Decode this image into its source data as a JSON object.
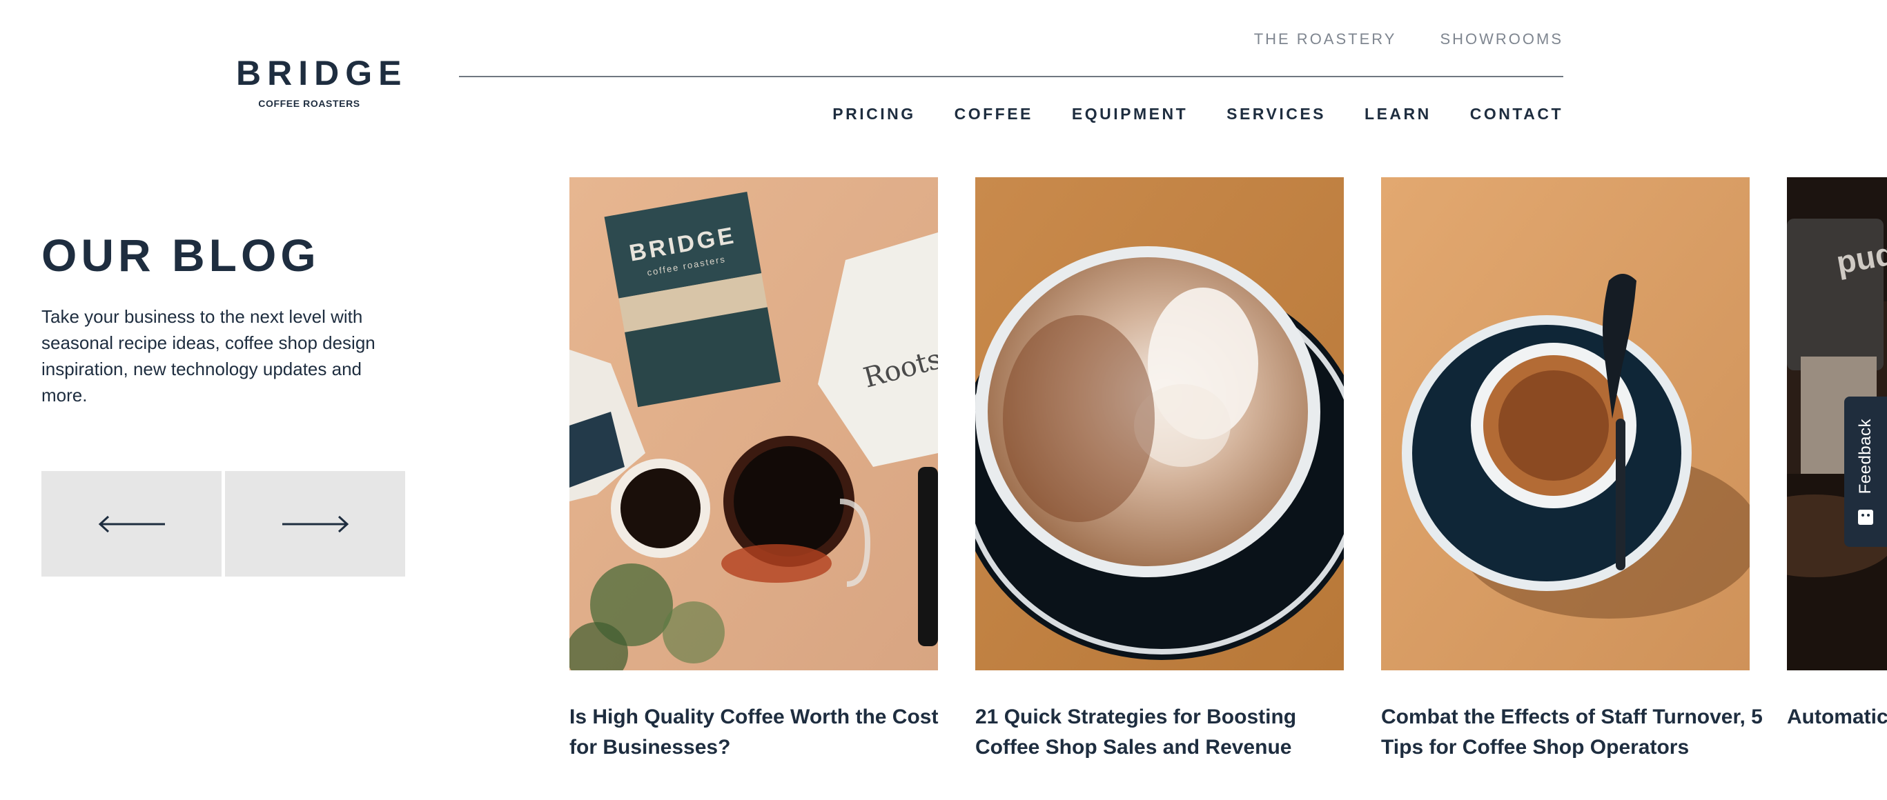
{
  "brand": {
    "name": "BRIDGE",
    "tagline": "COFFEE ROASTERS"
  },
  "util_nav": [
    {
      "label": "THE ROASTERY"
    },
    {
      "label": "SHOWROOMS"
    }
  ],
  "main_nav": [
    {
      "label": "PRICING"
    },
    {
      "label": "COFFEE"
    },
    {
      "label": "EQUIPMENT"
    },
    {
      "label": "SERVICES"
    },
    {
      "label": "LEARN"
    },
    {
      "label": "CONTACT"
    }
  ],
  "intro": {
    "title": "OUR BLOG",
    "description": "Take your business to the next level with seasonal recipe ideas, coffee shop design inspiration, new technology updates and more."
  },
  "carousel": {
    "prev_icon": "arrow-left-icon",
    "next_icon": "arrow-right-icon"
  },
  "posts": [
    {
      "title": "Is High Quality Coffee Worth the Cost for Businesses?",
      "image": "coffee-bag-and-cups-photo",
      "box_text": "BRIDGE",
      "box_subtext": "coffee roasters",
      "bag_text": "Roots"
    },
    {
      "title": "21 Quick Strategies for Boosting Coffee Shop Sales and Revenue",
      "image": "latte-art-photo"
    },
    {
      "title": "Combat the Effects of Staff Turnover, 5 Tips for Coffee Shop Operators",
      "image": "espresso-cup-photo"
    },
    {
      "title": "Automatic Reviewing",
      "image": "espresso-machine-photo",
      "machine_text": "puq"
    }
  ],
  "feedback": {
    "label": "Feedback",
    "icon": "smile-icon"
  },
  "colors": {
    "navy": "#1e2d3f",
    "muted_link": "#7f8690",
    "button_bg": "#e6e6e6",
    "feedback_bg": "#1f2d3d"
  }
}
